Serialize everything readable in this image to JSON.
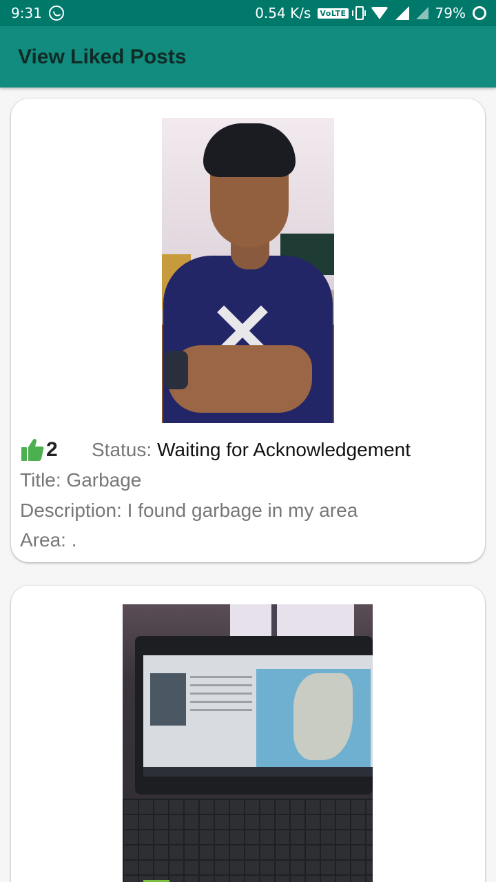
{
  "status_bar": {
    "time": "9:31",
    "net_speed": "0.54 K/s",
    "volte": "VoLTE",
    "battery": "79%"
  },
  "app_bar": {
    "title": "View Liked Posts"
  },
  "posts": [
    {
      "likes": "2",
      "status_label": "Status:",
      "status_value": "Waiting for Acknowledgement",
      "title": "Title: Garbage",
      "description": "Description: I found garbage in my area",
      "area": "Area: ."
    }
  ],
  "colors": {
    "status_bar": "#00796b",
    "app_bar": "#118c7f",
    "like_icon": "#4caf50",
    "card_bg": "#ffffff",
    "page_bg": "#f6f6f6"
  },
  "icons": {
    "whatsapp": "whatsapp-icon",
    "vibrate": "vibrate-icon",
    "wifi": "wifi-icon",
    "signal": "signal-icon",
    "battery": "battery-ring-icon",
    "like": "thumbs-up-icon"
  }
}
